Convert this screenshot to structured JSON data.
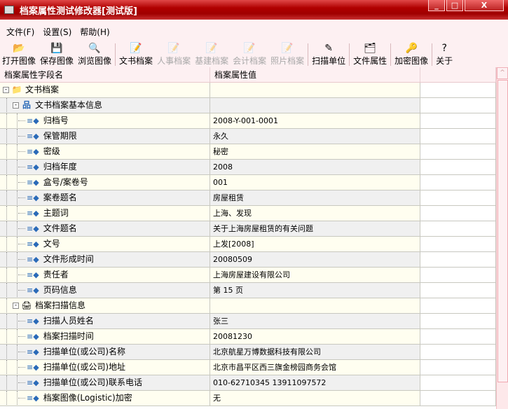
{
  "window": {
    "title": "档案属性测试修改器[测试版]",
    "minimize": "_",
    "maximize": "□",
    "close": "X"
  },
  "menu": [
    "文件(F)",
    "设置(S)",
    "帮助(H)"
  ],
  "toolbar": [
    {
      "label": "打开图像",
      "icon": "📂",
      "disabled": false
    },
    {
      "label": "保存图像",
      "icon": "💾",
      "disabled": false
    },
    {
      "label": "浏览图像",
      "icon": "🔍",
      "disabled": false,
      "sep": true
    },
    {
      "label": "文书档案",
      "icon": "📝",
      "disabled": false
    },
    {
      "label": "人事档案",
      "icon": "📝",
      "disabled": true
    },
    {
      "label": "基建档案",
      "icon": "📝",
      "disabled": true
    },
    {
      "label": "会计档案",
      "icon": "📝",
      "disabled": true
    },
    {
      "label": "照片档案",
      "icon": "📝",
      "disabled": true,
      "sep": true
    },
    {
      "label": "扫描单位",
      "icon": "✎",
      "disabled": false,
      "sep": true
    },
    {
      "label": "文件属性",
      "icon": "🗂",
      "disabled": false,
      "sep": true
    },
    {
      "label": "加密图像",
      "icon": "🔑",
      "disabled": false,
      "sep": true
    },
    {
      "label": "关于",
      "icon": "?",
      "disabled": false
    }
  ],
  "grid": {
    "headers": [
      "档案属性字段名",
      "档案属性值"
    ],
    "rows": [
      {
        "level": 0,
        "type": "root",
        "name": "文书档案",
        "value": ""
      },
      {
        "level": 1,
        "type": "group",
        "name": "文书档案基本信息",
        "value": ""
      },
      {
        "level": 2,
        "name": "归档号",
        "value": "2008-Y-001-0001"
      },
      {
        "level": 2,
        "name": "保管期限",
        "value": "永久"
      },
      {
        "level": 2,
        "name": "密级",
        "value": "秘密"
      },
      {
        "level": 2,
        "name": "归档年度",
        "value": "2008"
      },
      {
        "level": 2,
        "name": "盒号/案卷号",
        "value": "001"
      },
      {
        "level": 2,
        "name": "案卷题名",
        "value": "房屋租赁"
      },
      {
        "level": 2,
        "name": "主题词",
        "value": "上海、发现"
      },
      {
        "level": 2,
        "name": "文件题名",
        "value": "关于上海房屋租赁的有关问题"
      },
      {
        "level": 2,
        "name": "文号",
        "value": "上发[2008]"
      },
      {
        "level": 2,
        "name": "文件形成时间",
        "value": "20080509"
      },
      {
        "level": 2,
        "name": "责任者",
        "value": "上海房屋建设有限公司"
      },
      {
        "level": 2,
        "name": "页码信息",
        "value": "第 15 页"
      },
      {
        "level": 1,
        "type": "scan",
        "name": "档案扫描信息",
        "value": ""
      },
      {
        "level": 2,
        "name": "扫描人员姓名",
        "value": "张三"
      },
      {
        "level": 2,
        "name": "档案扫描时间",
        "value": "20081230"
      },
      {
        "level": 2,
        "name": "扫描单位(或公司)名称",
        "value": "北京航星万博数据科技有限公司"
      },
      {
        "level": 2,
        "name": "扫描单位(或公司)地址",
        "value": "北京市昌平区西三旗金榜园商务会馆"
      },
      {
        "level": 2,
        "name": "扫描单位(或公司)联系电话",
        "value": "010-62710345 13911097572"
      },
      {
        "level": 2,
        "name": "档案图像(Logistic)加密",
        "value": "无"
      }
    ]
  }
}
